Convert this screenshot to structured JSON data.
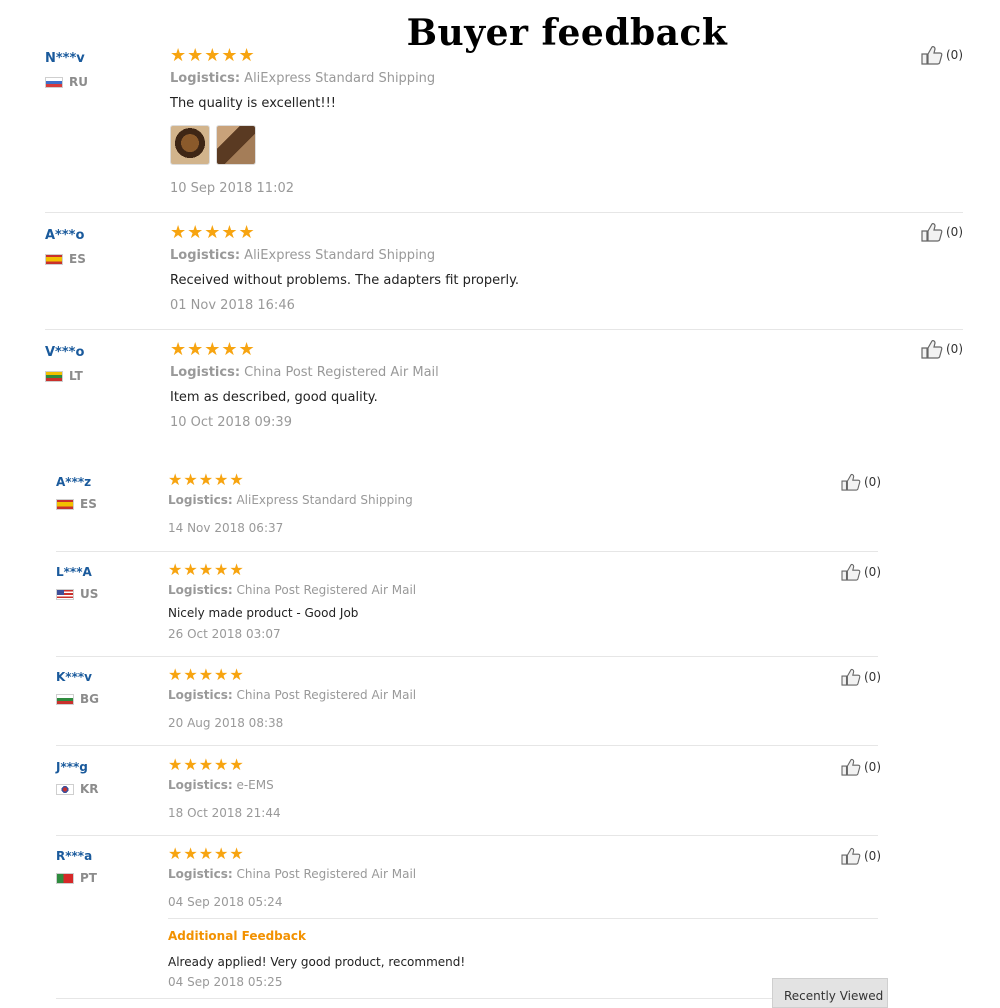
{
  "header": {
    "title": "Buyer feedback"
  },
  "colors": {
    "star": "#f7a410",
    "username": "#1a5a9c",
    "muted": "#999999",
    "additional_label": "#f29100"
  },
  "rating_stars": "★★★★★",
  "logistics_label": "Logistics:",
  "reviews": [
    {
      "user": "N***v",
      "country": "RU",
      "logistics": "AliExpress Standard Shipping",
      "text": "The quality is excellent!!!",
      "date": "10 Sep 2018 11:02",
      "likes": "(0)",
      "has_photos": true
    },
    {
      "user": "A***o",
      "country": "ES",
      "logistics": "AliExpress Standard Shipping",
      "text": "Received without problems. The adapters fit properly.",
      "date": "01 Nov 2018 16:46",
      "likes": "(0)"
    },
    {
      "user": "V***o",
      "country": "LT",
      "logistics": "China Post Registered Air Mail",
      "text": "Item as described, good quality.",
      "date": "10 Oct 2018 09:39",
      "likes": "(0)"
    },
    {
      "user": "A***z",
      "country": "ES",
      "logistics": "AliExpress Standard Shipping",
      "text": "",
      "date": "14 Nov 2018 06:37",
      "likes": "(0)"
    },
    {
      "user": "L***A",
      "country": "US",
      "logistics": "China Post Registered Air Mail",
      "text": "Nicely made product - Good Job",
      "date": "26 Oct 2018 03:07",
      "likes": "(0)"
    },
    {
      "user": "K***v",
      "country": "BG",
      "logistics": "China Post Registered Air Mail",
      "text": "",
      "date": "20 Aug 2018 08:38",
      "likes": "(0)"
    },
    {
      "user": "J***g",
      "country": "KR",
      "logistics": "e-EMS",
      "text": "",
      "date": "18 Oct 2018 21:44",
      "likes": "(0)"
    },
    {
      "user": "R***a",
      "country": "PT",
      "logistics": "China Post Registered Air Mail",
      "text": "",
      "date": "04 Sep 2018 05:24",
      "likes": "(0)",
      "additional": {
        "label": "Additional Feedback",
        "text": "Already applied! Very good product, recommend!",
        "date": "04 Sep 2018 05:25"
      }
    }
  ],
  "recently_viewed": "Recently Viewed"
}
